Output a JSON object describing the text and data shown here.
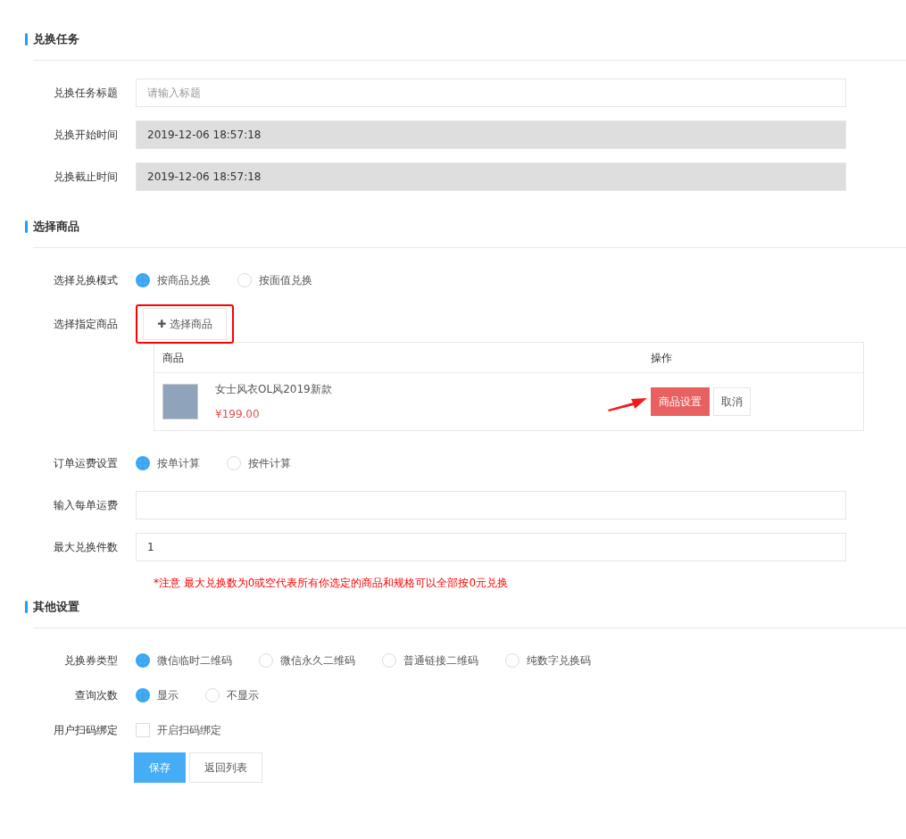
{
  "sections": [
    {
      "title": "兑换任务",
      "rows": [
        {
          "kind": "input",
          "label": "兑换任务标题",
          "placeholder": "请输入标题",
          "disabled": false
        },
        {
          "kind": "input",
          "label": "兑换开始时间",
          "value": "2019-12-06 18:57:18",
          "disabled": true
        },
        {
          "kind": "input",
          "label": "兑换截止时间",
          "value": "2019-12-06 18:57:18",
          "disabled": true
        }
      ]
    },
    {
      "title": "选择商品",
      "rows": [
        {
          "kind": "radio",
          "label": "选择兑换模式",
          "options": [
            {
              "label": "按商品兑换",
              "selected": true
            },
            {
              "label": "按面值兑换",
              "selected": false
            }
          ]
        },
        {
          "kind": "pick",
          "label": "选择指定商品",
          "button": "✚ 选择商品",
          "highlighted": true
        },
        {
          "kind": "table",
          "columns": [
            "商品",
            "操作"
          ],
          "rows": [
            {
              "name": "女士风衣OL风2019新款",
              "price": "¥199.00",
              "pointer_arrow": true,
              "actions": [
                {
                  "label": "商品设置",
                  "kind": "primary"
                },
                {
                  "label": "取消",
                  "kind": "plain"
                }
              ]
            }
          ]
        },
        {
          "kind": "radio",
          "label": "订单运费设置",
          "options": [
            {
              "label": "按单计算",
              "selected": true
            },
            {
              "label": "按件计算",
              "selected": false
            }
          ]
        },
        {
          "kind": "input",
          "label": "输入每单运费",
          "disabled": false
        },
        {
          "kind": "input",
          "label": "最大兑换件数",
          "value": "1",
          "disabled": false
        },
        {
          "kind": "note",
          "text": "*注意 最大兑换数为0或空代表所有你选定的商品和规格可以全部按0元兑换"
        }
      ]
    },
    {
      "title": "其他设置",
      "rows": [
        {
          "kind": "radio",
          "label": "兑换券类型",
          "options": [
            {
              "label": "微信临时二维码",
              "selected": true
            },
            {
              "label": "微信永久二维码",
              "selected": false
            },
            {
              "label": "普通链接二维码",
              "selected": false
            },
            {
              "label": "纯数字兑换码",
              "selected": false
            }
          ]
        },
        {
          "kind": "radio",
          "label": "查询次数",
          "options": [
            {
              "label": "显示",
              "selected": true
            },
            {
              "label": "不显示",
              "selected": false
            }
          ]
        },
        {
          "kind": "checkbox",
          "label": "用户扫码绑定",
          "text": "开启扫码绑定",
          "checked": false
        }
      ]
    }
  ],
  "buttons": [
    {
      "label": "保存",
      "kind": "primary"
    },
    {
      "label": "返回列表",
      "kind": "plain"
    }
  ]
}
